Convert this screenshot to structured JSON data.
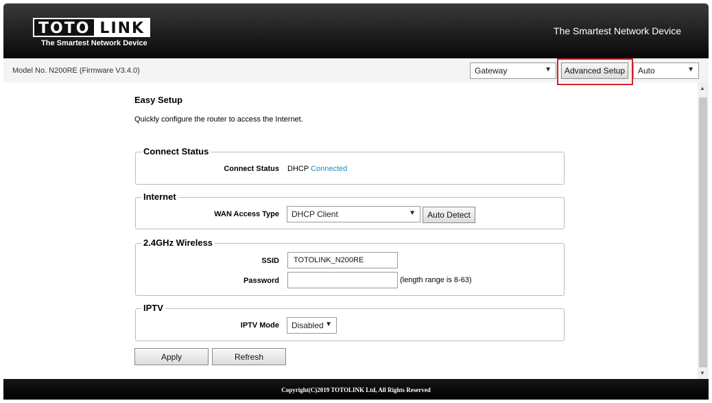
{
  "header": {
    "logo_left": "TOTO",
    "logo_right": "LINK",
    "logo_tagline": "The Smartest Network Device",
    "tagline": "The Smartest Network Device"
  },
  "topbar": {
    "model": "Model No. N200RE (Firmware V3.4.0)",
    "mode_select": "Gateway",
    "advanced_setup": "Advanced Setup",
    "language_select": "Auto"
  },
  "page": {
    "title": "Easy Setup",
    "description": "Quickly configure the router to access the Internet."
  },
  "connect_status": {
    "legend": "Connect Status",
    "label": "Connect Status",
    "type": "DHCP",
    "state": "Connected"
  },
  "internet": {
    "legend": "Internet",
    "wan_label": "WAN Access Type",
    "wan_value": "DHCP Client",
    "auto_detect": "Auto Detect"
  },
  "wireless": {
    "legend": "2.4GHz Wireless",
    "ssid_label": "SSID",
    "ssid_value": "TOTOLINK_N200RE",
    "password_label": "Password",
    "password_value": "",
    "password_hint": "(length range is 8-63)"
  },
  "iptv": {
    "legend": "IPTV",
    "mode_label": "IPTV Mode",
    "mode_value": "Disabled"
  },
  "actions": {
    "apply": "Apply",
    "refresh": "Refresh"
  },
  "footer": {
    "copyright": "Copyright(C)2019 TOTOLINK Ltd, All Rights Reserved"
  },
  "icons": {
    "dropdown": "▼",
    "scroll_up": "▲",
    "scroll_down": "▼"
  }
}
